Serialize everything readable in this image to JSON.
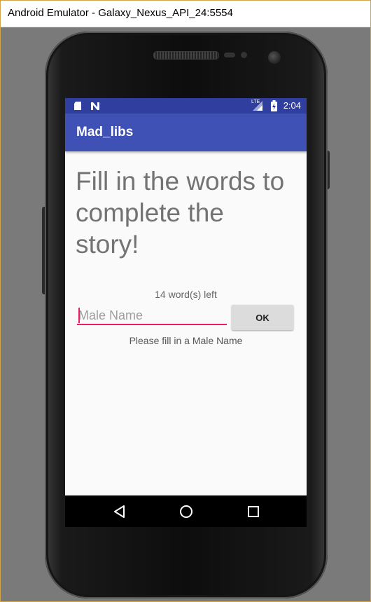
{
  "window": {
    "title": "Android Emulator - Galaxy_Nexus_API_24:5554"
  },
  "statusbar": {
    "time": "2:04",
    "network_label": "LTE",
    "left_icons": [
      "sd-card-icon",
      "notification-n-icon"
    ],
    "right_icons": [
      "lte-signal-icon",
      "battery-icon"
    ]
  },
  "appbar": {
    "title": "Mad_libs"
  },
  "main": {
    "headline": "Fill in the words to complete the story!",
    "words_left": "14 word(s) left",
    "input": {
      "placeholder": "Male Name",
      "value": ""
    },
    "ok_label": "OK",
    "hint": "Please fill in a Male Name"
  },
  "navbar": {
    "buttons": [
      "back-icon",
      "home-icon",
      "recents-icon"
    ]
  },
  "colors": {
    "primary": "#3f51b5",
    "primary_dark": "#303f9f",
    "accent": "#e91e63",
    "window_background": "#7a7a7a"
  }
}
